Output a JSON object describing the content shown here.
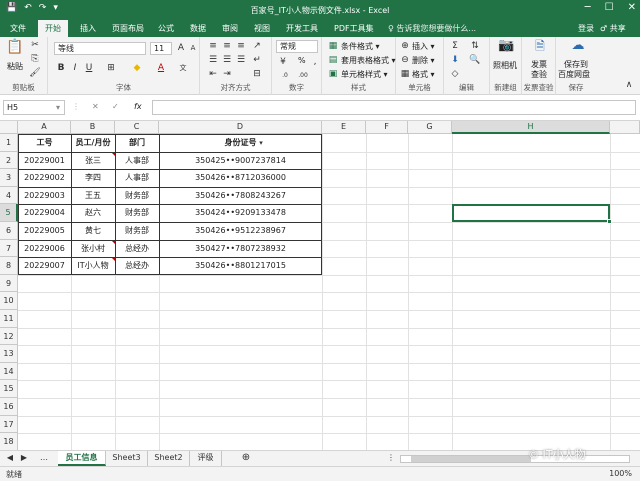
{
  "window": {
    "title": "百家号_IT小人物示例文件.xlsx - Excel",
    "qa_icons": [
      "save-icon",
      "undo-icon",
      "redo-icon",
      "customize-icon"
    ],
    "win_btns": [
      "─",
      "☐",
      "✕"
    ]
  },
  "tabs": [
    "文件",
    "开始",
    "插入",
    "页面布局",
    "公式",
    "数据",
    "审阅",
    "视图",
    "开发工具",
    "PDF工具集"
  ],
  "active_tab": "开始",
  "tellme": "♀ 告诉我您想要做什么...",
  "signin": "登录",
  "share": "♂ 共享",
  "ribbon": {
    "clipboard": {
      "label": "剪贴板",
      "paste": "粘贴"
    },
    "font": {
      "label": "字体",
      "name": "等线",
      "size": "11"
    },
    "alignment": {
      "label": "对齐方式"
    },
    "number": {
      "label": "数字",
      "format": "常规",
      "percent": "%"
    },
    "styles": {
      "label": "样式",
      "items": [
        "条件格式 ▾",
        "套用表格格式 ▾",
        "单元格样式 ▾"
      ]
    },
    "cells": {
      "label": "单元格",
      "items": [
        "插入 ▾",
        "删除 ▾",
        "格式 ▾"
      ]
    },
    "editing": {
      "label": "编辑"
    },
    "camera": {
      "label": "新建组",
      "btn": "照相机"
    },
    "invoice": {
      "label": "发票查验",
      "btn1": "发票",
      "btn2": "查验"
    },
    "save": {
      "label": "保存",
      "btn1": "保存到",
      "btn2": "百度网盘"
    }
  },
  "formula_bar": {
    "name_box": "H5",
    "fx": "fx",
    "cancel": "✕",
    "enter": "✓",
    "value": ""
  },
  "columns": [
    "A",
    "B",
    "C",
    "D",
    "E",
    "F",
    "G",
    "H"
  ],
  "selected_column": "H",
  "rows": [
    "1",
    "2",
    "3",
    "4",
    "5",
    "6",
    "7",
    "8",
    "9",
    "10",
    "11",
    "12",
    "13",
    "14",
    "15",
    "16",
    "17",
    "18"
  ],
  "selected_row": "5",
  "table": {
    "headers": [
      "工号",
      "员工/月份",
      "部门",
      "身份证号"
    ],
    "rows": [
      [
        "20229001",
        "张三",
        "人事部",
        "350425••9007237814"
      ],
      [
        "20229002",
        "李四",
        "人事部",
        "350426••8712036000"
      ],
      [
        "20229003",
        "王五",
        "财务部",
        "350426••7808243267"
      ],
      [
        "20229004",
        "赵六",
        "财务部",
        "350424••9209133478"
      ],
      [
        "20229005",
        "黄七",
        "财务部",
        "350426••9512238967"
      ],
      [
        "20229006",
        "张小村",
        "总经办",
        "350427••7807238932"
      ],
      [
        "20229007",
        "IT小人物",
        "总经办",
        "350426••8801217015"
      ]
    ]
  },
  "sheets": [
    "员工信息",
    "Sheet3",
    "Sheet2",
    "评级"
  ],
  "active_sheet": "员工信息",
  "status": "就绪",
  "zoom": "100%",
  "watermark": "© IT小人物"
}
